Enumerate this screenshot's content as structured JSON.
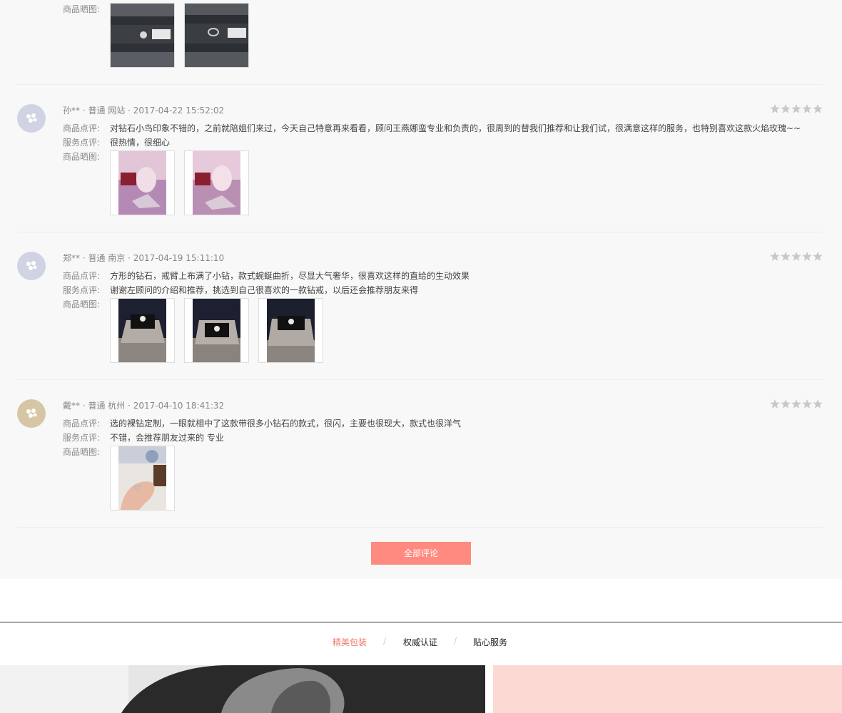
{
  "reviews": [
    {
      "labels": {
        "photos": "商品晒图:"
      },
      "photos": [
        "ring-box-photo-1",
        "ring-box-photo-2"
      ]
    },
    {
      "meta": "孙** · 普通 网站 · 2017-04-22 15:52:02",
      "product_label": "商品点评:",
      "product_review": "对钻石小鸟印象不错的，之前就陪姐们来过，今天自己特意再来看看，顾问王燕娜蛮专业和负责的，很周到的替我们推荐和让我们试，很满意这样的服务，也特别喜欢这款火焰玫瑰~~",
      "service_label": "服务点评:",
      "service_review": "很热情，很细心",
      "photos_label": "商品晒图:",
      "rating": 5,
      "avatar_color": "#cfd3e3"
    },
    {
      "meta": "郑** · 普通 南京 · 2017-04-19 15:11:10",
      "product_label": "商品点评:",
      "product_review": "方形的钻石，戒臂上布满了小钻，款式蜿蜒曲折，尽显大气奢华，很喜欢这样的直给的生动效果",
      "service_label": "服务点评:",
      "service_review": "谢谢左顾问的介绍和推荐，挑选到自己很喜欢的一款钻戒，以后还会推荐朋友来得",
      "photos_label": "商品晒图:",
      "rating": 5,
      "avatar_color": "#cfd3e3"
    },
    {
      "meta": "戴** · 普通 杭州 · 2017-04-10 18:41:32",
      "product_label": "商品点评:",
      "product_review": "选的裸钻定制，一眼就相中了这款带很多小钻石的款式，很闪，主要也很现大，款式也很洋气",
      "service_label": "服务点评:",
      "service_review": "不错，会推荐朋友过来的 专业",
      "photos_label": "商品晒图:",
      "rating": 5,
      "avatar_color": "#d6c6a6"
    }
  ],
  "all_reviews_button": "全部评论",
  "tabs": [
    {
      "label": "精美包装",
      "active": true
    },
    {
      "label": "权威认证",
      "active": false
    },
    {
      "label": "贴心服务",
      "active": false
    }
  ],
  "tab_separator": "/",
  "colors": {
    "accent": "#ff8a80",
    "active_tab": "#f07a6c",
    "panel_bg": "#f8f8f8",
    "pink_panel": "#fdd9d4"
  }
}
